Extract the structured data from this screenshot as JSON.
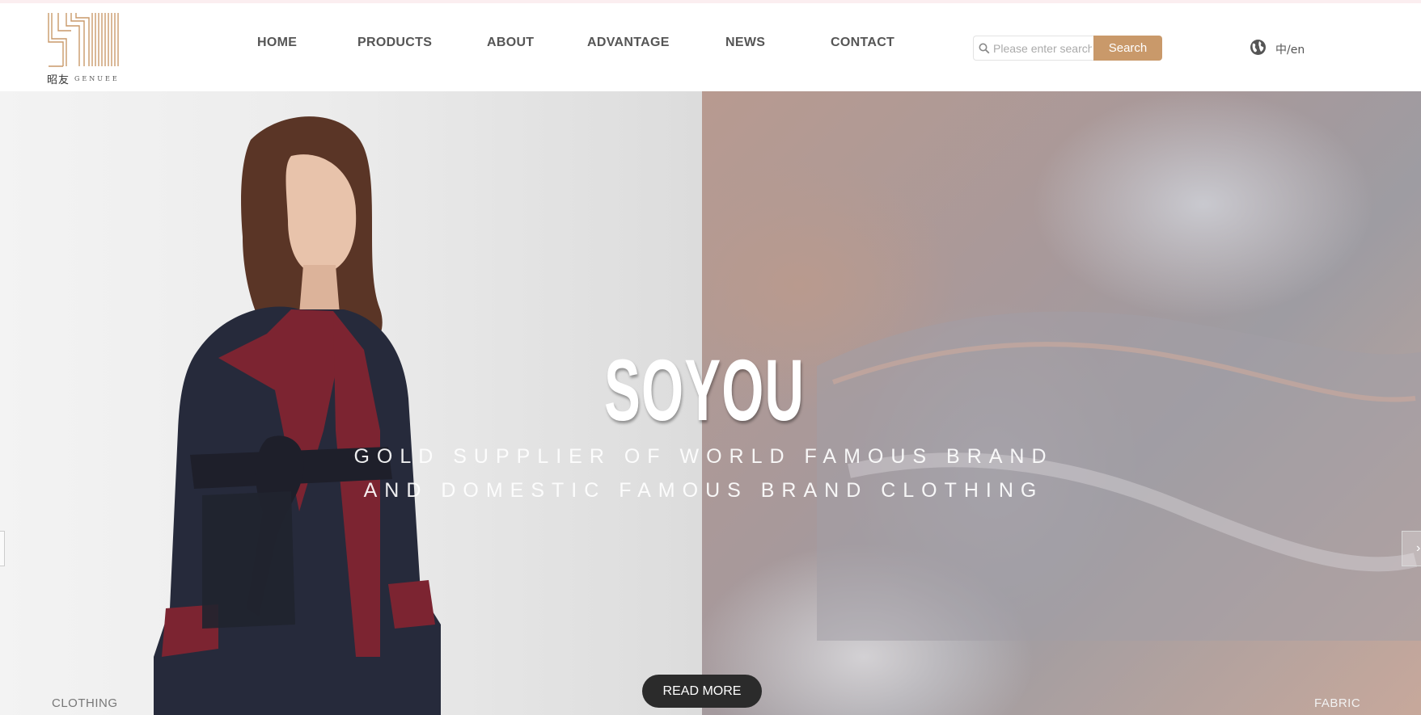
{
  "brand": {
    "logo_cn": "昭友",
    "logo_en": "GENUEE",
    "accent": "#c9996a"
  },
  "nav": {
    "items": [
      "HOME",
      "PRODUCTS",
      "ABOUT",
      "ADVANTAGE",
      "NEWS",
      "CONTACT"
    ]
  },
  "search": {
    "placeholder": "Please enter search",
    "button_label": "Search"
  },
  "lang": {
    "label": "中/en",
    "icon": "globe-icon"
  },
  "hero": {
    "title": "SOYOU",
    "subtitle_line1": "GOLD SUPPLIER OF WORLD FAMOUS BRAND",
    "subtitle_line2": "AND DOMESTIC FAMOUS BRAND CLOTHING",
    "cta_label": "READ MORE",
    "left_label": "CLOTHING",
    "right_label": "FABRIC",
    "next_arrow": "›"
  }
}
